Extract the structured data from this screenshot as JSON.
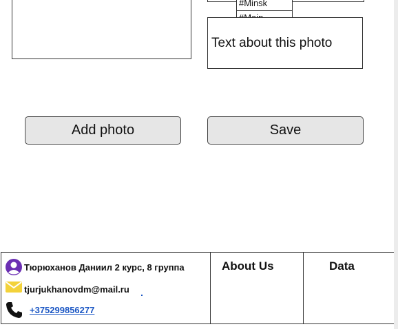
{
  "tags": [
    "#Minsk",
    "#Main"
  ],
  "description": {
    "text": "Text about this photo"
  },
  "buttons": {
    "add_photo": "Add photo",
    "save": "Save"
  },
  "footer": {
    "name": "Тюрюханов Даниил  2 курс, 8 группа",
    "email": "tjurjukhanovdm@mail.ru",
    "phone": "+375299856277",
    "about_title": "About Us",
    "data_title": "Data",
    "icons": {
      "user": "user-circle-icon",
      "mail": "envelope-icon",
      "phone": "phone-icon"
    }
  },
  "colors": {
    "user_icon": "#6b2fb3",
    "mail_icon": "#f3d23a",
    "link": "#1a56c4"
  }
}
